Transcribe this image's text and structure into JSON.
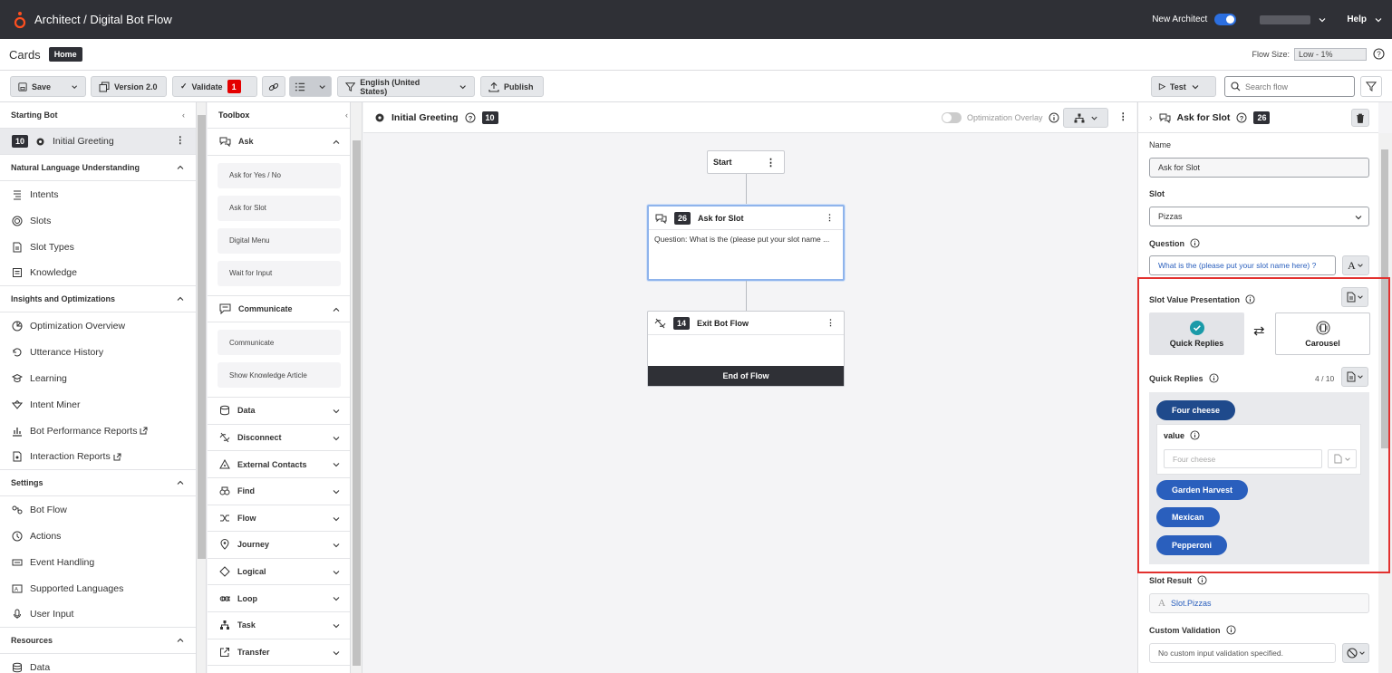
{
  "topbar": {
    "breadcrumb": "Architect / Digital Bot Flow",
    "new_architect_label": "New Architect",
    "help_label": "Help"
  },
  "cards_row": {
    "title": "Cards",
    "home_badge": "Home",
    "flow_size_label": "Flow Size:",
    "flow_size_value": "Low - 1%"
  },
  "toolbar": {
    "save_label": "Save",
    "version_label": "Version 2.0",
    "validate_label": "Validate",
    "validate_count": "1",
    "language_label": "English (United States)",
    "publish_label": "Publish",
    "test_label": "Test",
    "search_placeholder": "Search flow"
  },
  "leftnav": {
    "starting_bot_label": "Starting Bot",
    "starting_bot_item": {
      "count": "10",
      "label": "Initial Greeting"
    },
    "sections": [
      {
        "title": "Natural Language Understanding",
        "items": [
          {
            "label": "Intents",
            "icon": "intents-icon"
          },
          {
            "label": "Slots",
            "icon": "slots-icon"
          },
          {
            "label": "Slot Types",
            "icon": "slot-types-icon"
          },
          {
            "label": "Knowledge",
            "icon": "knowledge-icon"
          }
        ]
      },
      {
        "title": "Insights and Optimizations",
        "items": [
          {
            "label": "Optimization Overview",
            "icon": "optimization-icon"
          },
          {
            "label": "Utterance History",
            "icon": "history-icon"
          },
          {
            "label": "Learning",
            "icon": "learning-icon"
          },
          {
            "label": "Intent Miner",
            "icon": "miner-icon"
          },
          {
            "label": "Bot Performance Reports",
            "icon": "reports-icon"
          },
          {
            "label": "Interaction Reports",
            "icon": "interaction-reports-icon"
          }
        ]
      },
      {
        "title": "Settings",
        "items": [
          {
            "label": "Bot Flow",
            "icon": "bot-flow-icon"
          },
          {
            "label": "Actions",
            "icon": "actions-icon"
          },
          {
            "label": "Event Handling",
            "icon": "event-icon"
          },
          {
            "label": "Supported Languages",
            "icon": "languages-icon"
          },
          {
            "label": "User Input",
            "icon": "mic-icon"
          }
        ]
      },
      {
        "title": "Resources",
        "items": [
          {
            "label": "Data",
            "icon": "data-icon"
          }
        ]
      }
    ]
  },
  "toolbox": {
    "title": "Toolbox",
    "ask_label": "Ask",
    "ask_items": [
      "Ask for Yes / No",
      "Ask for Slot",
      "Digital Menu",
      "Wait for Input"
    ],
    "communicate_label": "Communicate",
    "communicate_items": [
      "Communicate",
      "Show Knowledge Article"
    ],
    "collapsed_sections": [
      "Data",
      "Disconnect",
      "External Contacts",
      "Find",
      "Flow",
      "Journey",
      "Logical",
      "Loop",
      "Task",
      "Transfer"
    ]
  },
  "canvas": {
    "title": "Initial Greeting",
    "count": "10",
    "overlay_label": "Optimization Overlay",
    "start_label": "Start",
    "ask_node": {
      "count": "26",
      "title": "Ask for Slot",
      "body": "Question: What is the (please put your slot name ..."
    },
    "exit_node": {
      "count": "14",
      "title": "Exit Bot Flow",
      "footer": "End of Flow"
    }
  },
  "rightpanel": {
    "title": "Ask for Slot",
    "count": "26",
    "name_label": "Name",
    "name_value": "Ask for Slot",
    "slot_label": "Slot",
    "slot_value": "Pizzas",
    "question_label": "Question",
    "question_value": "What is the (please put your slot name here) ?",
    "svp_label": "Slot Value Presentation",
    "option_quick_replies": "Quick Replies",
    "option_carousel": "Carousel",
    "quick_replies_label": "Quick Replies",
    "quick_replies_count": "4 / 10",
    "replies": [
      "Four cheese",
      "Garden Harvest",
      "Mexican",
      "Pepperoni"
    ],
    "value_label": "value",
    "value_placeholder": "Four cheese",
    "slot_result_label": "Slot Result",
    "slot_result_value": "Slot.Pizzas",
    "custom_validation_label": "Custom Validation",
    "custom_validation_value": "No custom input validation specified."
  },
  "colors": {
    "topbar": "#2f3036",
    "accent": "#2a5fbd",
    "highlight": "#e2312f",
    "teal": "#1a9aa8",
    "validate_badge": "#e40000"
  }
}
